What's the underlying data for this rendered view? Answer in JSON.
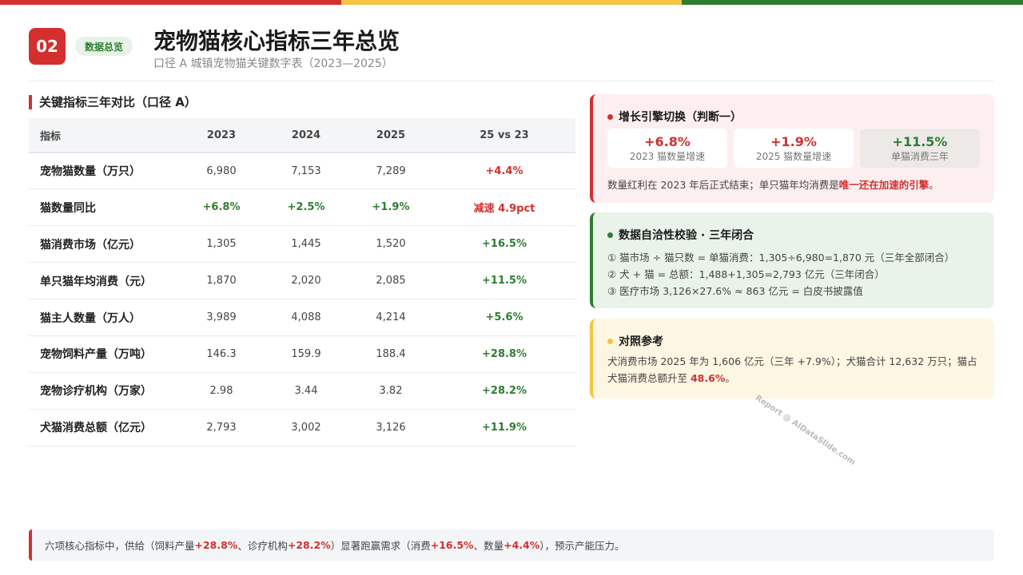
{
  "colors": {
    "red": "#d32f2f",
    "yellow": "#f6c343",
    "green": "#2e7d32"
  },
  "header": {
    "page_number": "02",
    "section_badge": "数据总览",
    "title": "宠物猫核心指标三年总览",
    "subtitle": "口径 A 城镇宠物猫关键数字表（2023—2025）"
  },
  "table": {
    "heading": "关键指标三年对比（口径 A）",
    "columns": [
      "指标",
      "2023",
      "2024",
      "2025",
      "25 vs 23"
    ],
    "rows": [
      {
        "name": "宠物猫数量（万只）",
        "y2023": "6,980",
        "y2024": "7,153",
        "y2025": "7,289",
        "delta": "+4.4%"
      },
      {
        "name": "猫数量同比",
        "y2023": "+6.8%",
        "y2024": "+2.5%",
        "y2025": "+1.9%",
        "delta": "减速 4.9pct"
      },
      {
        "name": "猫消费市场（亿元）",
        "y2023": "1,305",
        "y2024": "1,445",
        "y2025": "1,520",
        "delta": "+16.5%"
      },
      {
        "name": "单只猫年均消费（元）",
        "y2023": "1,870",
        "y2024": "2,020",
        "y2025": "2,085",
        "delta": "+11.5%"
      },
      {
        "name": "猫主人数量（万人）",
        "y2023": "3,989",
        "y2024": "4,088",
        "y2025": "4,214",
        "delta": "+5.6%"
      },
      {
        "name": "宠物饲料产量（万吨）",
        "y2023": "146.3",
        "y2024": "159.9",
        "y2025": "188.4",
        "delta": "+28.8%"
      },
      {
        "name": "宠物诊疗机构（万家）",
        "y2023": "2.98",
        "y2024": "3.44",
        "y2025": "3.82",
        "delta": "+28.2%"
      },
      {
        "name": "犬猫消费总额（亿元）",
        "y2023": "2,793",
        "y2024": "3,002",
        "y2025": "3,126",
        "delta": "+11.9%"
      }
    ]
  },
  "growth_card": {
    "title": "增长引擎切换（判断一）",
    "stats": [
      {
        "value": "+6.8%",
        "label": "2023 猫数量增速"
      },
      {
        "value": "+1.9%",
        "label": "2025 猫数量增速"
      },
      {
        "value": "+11.5%",
        "label": "单猫消费三年"
      }
    ],
    "note_prefix": "数量红利在 2023 年后正式结束；单只猫年均消费是",
    "note_emphasis": "唯一还在加速的引擎",
    "note_suffix": "。"
  },
  "check_card": {
    "title": "数据自洽性校验 · 三年闭合",
    "items": [
      "① 猫市场 ÷ 猫只数 = 单猫消费：1,305÷6,980=1,870 元（三年全部闭合）",
      "② 犬 + 猫 = 总额：1,488+1,305=2,793 亿元（三年闭合）",
      "③ 医疗市场 3,126×27.6% ≈ 863 亿元 = 白皮书披露值"
    ]
  },
  "reference_card": {
    "title": "对照参考",
    "text_prefix": "犬消费市场 2025 年为 1,606 亿元（三年 +7.9%）；犬猫合计 12,632 万只；猫占犬猫消费总额升至 ",
    "text_emphasis": "48.6%",
    "text_suffix": "。"
  },
  "watermark": "Report @ AIDataSlide.com",
  "footer": {
    "p1": "六项核心指标中，供给（饲料产量 ",
    "v1": "+28.8%",
    "p2": "、诊疗机构 ",
    "v2": "+28.2%",
    "p3": "）显著跑赢需求（消费 ",
    "v3": "+16.5%",
    "p4": "、数量 ",
    "v4": "+4.4%",
    "p5": "），预示产能压力。"
  }
}
